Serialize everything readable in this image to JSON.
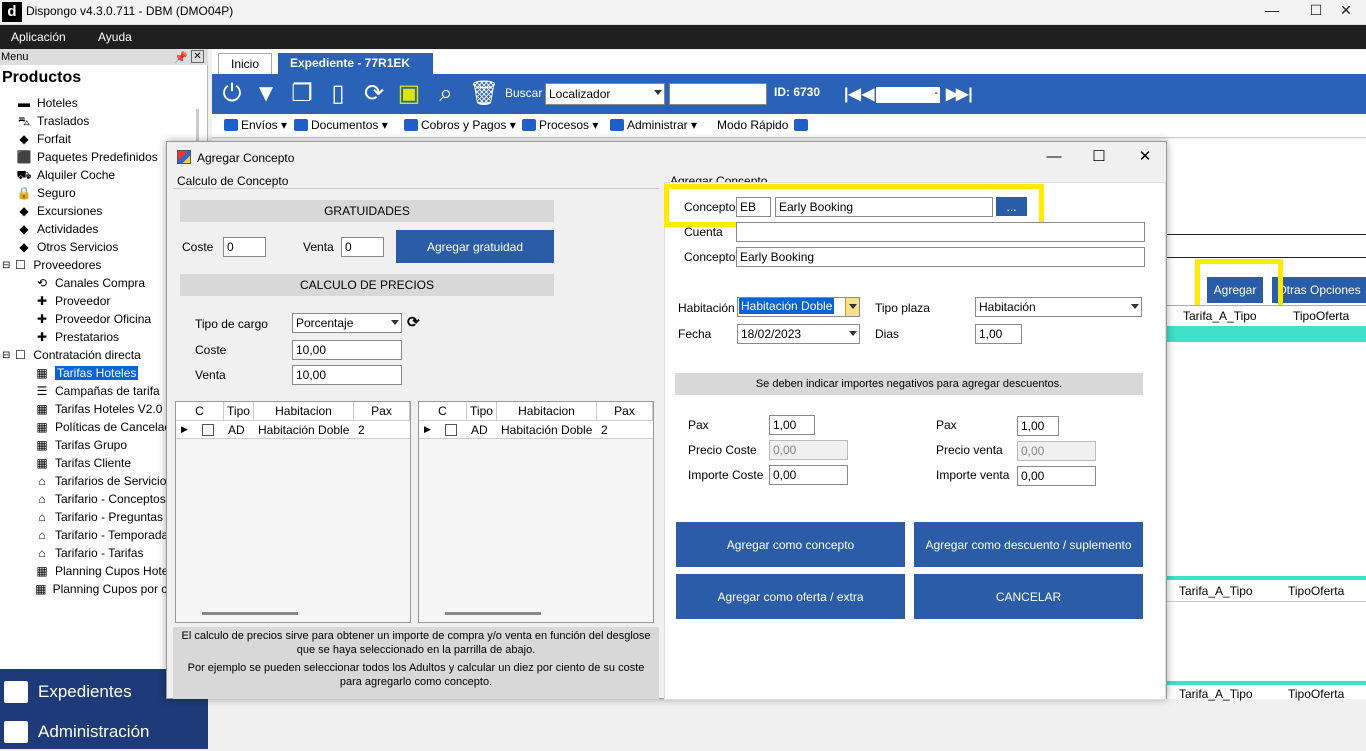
{
  "window": {
    "title": "Dispongo v4.3.0.711 - DBM (DMO04P)",
    "logo": "d"
  },
  "menubar": [
    "Aplicación",
    "Ayuda"
  ],
  "left": {
    "menu_label": "Menu",
    "section_title": "Productos",
    "items": [
      "Hoteles",
      "Traslados",
      "Forfait",
      "Paquetes Predefinidos",
      "Alquiler Coche",
      "Seguro",
      "Excursiones",
      "Actividades",
      "Otros Servicios",
      "Proveedores",
      "Canales Compra",
      "Proveedor",
      "Proveedor Oficina",
      "Prestatarios",
      "Contratación directa",
      "Tarifas Hoteles",
      "Campañas de tarifa",
      "Tarifas Hoteles V2.0",
      "Políticas de Cancelación",
      "Tarifas Grupo",
      "Tarifas Cliente",
      "Tarifarios de Servicios",
      "Tarifario - Conceptos",
      "Tarifario - Preguntas",
      "Tarifario - Temporadas",
      "Tarifario - Tarifas",
      "Planning Cupos Hoteles",
      "Planning Cupos por cliente"
    ],
    "bottom": [
      "Expedientes",
      "Administración"
    ]
  },
  "tabs": {
    "inicio": "Inicio",
    "expediente": "Expediente  - 77R1EK"
  },
  "toolbar": {
    "buscar": "Buscar",
    "localizador": "Localizador",
    "id": "ID: 6730",
    "nav_value": "-"
  },
  "actions": {
    "envios": "Envíos",
    "documentos": "Documentos",
    "cobros": "Cobros y Pagos",
    "procesos": "Procesos",
    "administrar": "Administrar",
    "modo": "Modo Rápido"
  },
  "background": {
    "agregar": "Agregar",
    "otras": "Otras Opciones",
    "col1": "Tarifa_A_Tipo",
    "col2": "TipoOferta"
  },
  "dialog": {
    "title": "Agregar Concepto",
    "calc_group": "Calculo de Concepto",
    "gratuidades": "GRATUIDADES",
    "coste_label": "Coste",
    "coste_value": "0",
    "venta_label": "Venta",
    "venta_value": "0",
    "agregar_gratuidad": "Agregar gratuidad",
    "calculo_precios": "CALCULO DE PRECIOS",
    "tipo_cargo_label": "Tipo de cargo",
    "tipo_cargo_value": "Porcentaje",
    "coste2_label": "Coste",
    "coste2_value": "10,00",
    "venta2_label": "Venta",
    "venta2_value": "10,00",
    "grid_headers": [
      "C",
      "Tipo",
      "Habitacion",
      "Pax"
    ],
    "grid_row": [
      "AD",
      "Habitación Doble",
      "2"
    ],
    "info1": "El calculo de precios sirve para obtener un importe de compra y/o venta en función del desglose que se haya seleccionado en la parrilla de abajo.",
    "info2": "Por ejemplo se pueden seleccionar todos los Adultos y calcular un diez por ciento de su coste para agregarlo como concepto.",
    "add_group": "Agregar Concepto",
    "concepto_label": "Concepto",
    "concepto_code": "EB",
    "concepto_name": "Early Booking",
    "dots": "...",
    "cuenta_label": "Cuenta",
    "concepto2_label": "Concepto",
    "concepto2_value": "Early Booking",
    "habitacion_label": "Habitación",
    "habitacion_value": "Habitación Doble",
    "tipo_plaza_label": "Tipo plaza",
    "tipo_plaza_value": "Habitación",
    "fecha_label": "Fecha",
    "fecha_value": "18/02/2023",
    "dias_label": "Dias",
    "dias_value": "1,00",
    "aviso": "Se deben indicar importes negativos para agregar descuentos.",
    "pax_label": "Pax",
    "pax_value": "1,00",
    "precio_coste_label": "Precio Coste",
    "precio_coste_value": "0,00",
    "importe_coste_label": "Importe Coste",
    "importe_coste_value": "0,00",
    "pax2_label": "Pax",
    "pax2_value": "1,00",
    "precio_venta_label": "Precio venta",
    "precio_venta_value": "0,00",
    "importe_venta_label": "Importe venta",
    "importe_venta_value": "0,00",
    "btn_concepto": "Agregar como concepto",
    "btn_descuento": "Agregar como descuento / suplemento",
    "btn_oferta": "Agregar como oferta / extra",
    "btn_cancelar": "CANCELAR"
  },
  "colors": {
    "accent": "#2a5ca8",
    "highlight": "#ffea00",
    "teal": "#40e0c8"
  }
}
